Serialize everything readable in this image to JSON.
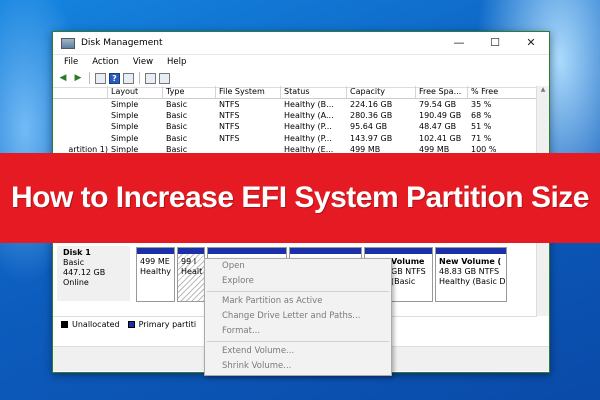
{
  "window": {
    "title": "Disk Management",
    "controls": {
      "minimize": "—",
      "maximize": "☐",
      "close": "✕"
    }
  },
  "menu": [
    "File",
    "Action",
    "View",
    "Help"
  ],
  "toolbar": {
    "back": "◀",
    "forward": "▶",
    "help": "?"
  },
  "volume_table": {
    "headers": [
      "Layout",
      "Type",
      "File System",
      "Status",
      "Capacity",
      "Free Spa...",
      "% Free"
    ],
    "rows": [
      {
        "volume": "",
        "layout": "Simple",
        "type": "Basic",
        "fs": "NTFS",
        "status": "Healthy (B...",
        "capacity": "224.16 GB",
        "free": "79.54 GB",
        "pct": "35 %"
      },
      {
        "volume": "",
        "layout": "Simple",
        "type": "Basic",
        "fs": "NTFS",
        "status": "Healthy (A...",
        "capacity": "280.36 GB",
        "free": "190.49 GB",
        "pct": "68 %"
      },
      {
        "volume": "",
        "layout": "Simple",
        "type": "Basic",
        "fs": "NTFS",
        "status": "Healthy (P...",
        "capacity": "95.64 GB",
        "free": "48.47 GB",
        "pct": "51 %"
      },
      {
        "volume": "",
        "layout": "Simple",
        "type": "Basic",
        "fs": "NTFS",
        "status": "Healthy (P...",
        "capacity": "143.97 GB",
        "free": "102.41 GB",
        "pct": "71 %"
      },
      {
        "volume": "artition 1)",
        "layout": "Simple",
        "type": "Basic",
        "fs": "",
        "status": "Healthy (E...",
        "capacity": "499 MB",
        "free": "499 MB",
        "pct": "100 %"
      }
    ]
  },
  "banner": {
    "text": "How to Increase EFI System Partition Size"
  },
  "disk": {
    "name": "Disk 1",
    "type": "Basic",
    "size": "447.12 GB",
    "state": "Online"
  },
  "partitions": [
    {
      "title": "",
      "line1": "499 ME",
      "line2": "Healthy"
    },
    {
      "title": "",
      "line1": "99 I",
      "line2": "Healt"
    },
    {
      "title": "Volume",
      "line1": "GB NTFS",
      "line2": "(Basic"
    },
    {
      "title": "New Volume  (",
      "line1": "48.83 GB NTFS",
      "line2": "Healthy (Basic D"
    }
  ],
  "context_menu": [
    "Open",
    "Explore",
    "Mark Partition as Active",
    "Change Drive Letter and Paths...",
    "Format...",
    "Extend Volume...",
    "Shrink Volume..."
  ],
  "legend": [
    {
      "label": "Unallocated",
      "color": "#000000"
    },
    {
      "label": "Primary partiti",
      "color": "#1a2fa8"
    }
  ],
  "colors": {
    "banner": "#e51a22",
    "partition_bar": "#1a2fa8",
    "window_border": "#2f7d32"
  }
}
